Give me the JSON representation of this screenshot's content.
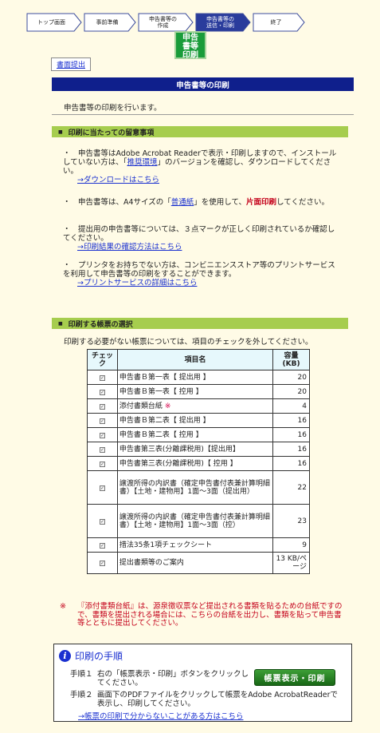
{
  "steps": [
    {
      "label": "トップ画面"
    },
    {
      "label": "事前準備"
    },
    {
      "label": "申告書等の\n作成"
    },
    {
      "label": "申告書等の\n送信・印刷"
    },
    {
      "label": "終了"
    }
  ],
  "current_step_mark": "申告\n書等\n印刷",
  "submit_button": "書面提出",
  "page_title": "申告書等の印刷",
  "intro": "申告書等の印刷を行います。",
  "notes_section": {
    "title": "印刷に当たっての留意事項",
    "notes": [
      {
        "pre": "・　申告書等はAdobe Acrobat Readerで表示・印刷しますので、インストールしていない方は、「",
        "link": "推奨環境",
        "post": "」のバージョンを確認し、ダウンロードしてください。",
        "sublink": "→ダウンロードはこちら"
      },
      {
        "pre": "・　申告書等は、A4サイズの「",
        "link": "普通紙",
        "mid": "」を使用して、",
        "red": "片面印刷",
        "post": "してください。"
      },
      {
        "pre": "・　提出用の申告書等については、３点マークが正しく印刷されているか確認してください。",
        "sublink": "→印刷結果の確認方法はこちら"
      },
      {
        "pre": "・　プリンタをお持ちでない方は、コンビニエンスストア等のプリントサービスを利用して申告書等の印刷をすることができます。",
        "sublink": "→プリントサービスの詳細はこちら"
      }
    ]
  },
  "forms_section": {
    "title": "印刷する帳票の選択",
    "lead": "印刷する必要がない帳票については、項目のチェックを外してください。",
    "columns": {
      "check": "チェック",
      "name": "項目名",
      "size": "容量\n(KB)"
    },
    "rows": [
      {
        "name": "申告書Ｂ第一表【 提出用 】",
        "size": "20"
      },
      {
        "name": "申告書Ｂ第一表【 控用 】",
        "size": "20"
      },
      {
        "name": "添付書類台紙",
        "mark": "※",
        "size": "4"
      },
      {
        "name": "申告書Ｂ第二表【 提出用 】",
        "size": "16"
      },
      {
        "name": "申告書Ｂ第二表【 控用 】",
        "size": "16"
      },
      {
        "name": "申告書第三表(分離課税用)【提出用】",
        "size": "16"
      },
      {
        "name": "申告書第三表(分離課税用)【 控用 】",
        "size": "16"
      },
      {
        "name": "譲渡所得の内訳書（確定申告書付表兼計算明細書）【土地・建物用】1面～3面（提出用）",
        "size": "22"
      },
      {
        "name": "譲渡所得の内訳書（確定申告書付表兼計算明細書）【土地・建物用】1面～3面（控）",
        "size": "23"
      },
      {
        "name": "措法35条1項チェックシート",
        "size": "9"
      },
      {
        "name": "提出書類等のご案内",
        "size": "13 KB/ページ"
      }
    ]
  },
  "footnote": {
    "mark": "※",
    "text": "『添付書類台紙』は、源泉徴収票など提出される書類を貼るための台紙ですので、書類を提出される場合には、こちらの台紙を出力し、書類を貼って申告書等とともに提出してください。"
  },
  "procedure": {
    "title": "印刷の手順",
    "step1_label": "手順１",
    "step1_text": "右の「帳票表示・印刷」ボタンをクリックしてください。",
    "step2_label": "手順２",
    "step2_text": "画面下のPDFファイルをクリックして帳票をAdobe AcrobatReaderで表示し、印刷してください。",
    "print_button": "帳票表示・印刷",
    "help_link": "→帳票の印刷で分からないことがある方はこちら"
  },
  "colors": {
    "title_bar": "#0f1f8c",
    "section_bar": "#a6cd4e",
    "current_step": "#1a9c3a",
    "print_button": "#2a7d25",
    "alert_text": "#c4001a",
    "link": "#1a30d0"
  },
  "icons": {
    "info": "info-circle-icon",
    "checkbox": "checkbox-checked-icon"
  }
}
